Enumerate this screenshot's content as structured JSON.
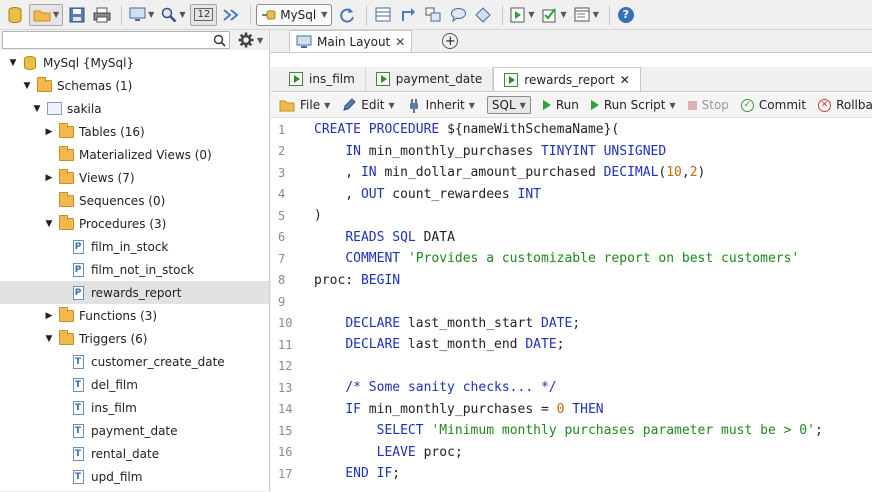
{
  "toolbar": {
    "connection_label": "MySql",
    "badge_number": "12",
    "help_glyph": "?"
  },
  "search": {
    "value": "",
    "placeholder": ""
  },
  "tree": [
    {
      "label": "MySql {MySql}",
      "level": 0,
      "arrow": "down",
      "icon": "database"
    },
    {
      "label": "Schemas (1)",
      "level": 1,
      "arrow": "down",
      "icon": "folder"
    },
    {
      "label": "sakila",
      "level": 2,
      "arrow": "down",
      "icon": "schema"
    },
    {
      "label": "Tables (16)",
      "level": 3,
      "arrow": "right",
      "icon": "folder"
    },
    {
      "label": "Materialized Views (0)",
      "level": 3,
      "arrow": "none",
      "icon": "folder"
    },
    {
      "label": "Views (7)",
      "level": 3,
      "arrow": "right",
      "icon": "folder"
    },
    {
      "label": "Sequences (0)",
      "level": 3,
      "arrow": "none",
      "icon": "folder"
    },
    {
      "label": "Procedures (3)",
      "level": 3,
      "arrow": "down",
      "icon": "folder"
    },
    {
      "label": "film_in_stock",
      "level": 4,
      "arrow": "none",
      "icon": "procedure",
      "glyph": "P"
    },
    {
      "label": "film_not_in_stock",
      "level": 4,
      "arrow": "none",
      "icon": "procedure",
      "glyph": "P"
    },
    {
      "label": "rewards_report",
      "level": 4,
      "arrow": "none",
      "icon": "procedure",
      "glyph": "P",
      "selected": true
    },
    {
      "label": "Functions (3)",
      "level": 3,
      "arrow": "right",
      "icon": "folder"
    },
    {
      "label": "Triggers (6)",
      "level": 3,
      "arrow": "down",
      "icon": "folder"
    },
    {
      "label": "customer_create_date",
      "level": 4,
      "arrow": "none",
      "icon": "trigger",
      "glyph": "T"
    },
    {
      "label": "del_film",
      "level": 4,
      "arrow": "none",
      "icon": "trigger",
      "glyph": "T"
    },
    {
      "label": "ins_film",
      "level": 4,
      "arrow": "none",
      "icon": "trigger",
      "glyph": "T"
    },
    {
      "label": "payment_date",
      "level": 4,
      "arrow": "none",
      "icon": "trigger",
      "glyph": "T"
    },
    {
      "label": "rental_date",
      "level": 4,
      "arrow": "none",
      "icon": "trigger",
      "glyph": "T"
    },
    {
      "label": "upd_film",
      "level": 4,
      "arrow": "none",
      "icon": "trigger",
      "glyph": "T"
    }
  ],
  "main_tab": {
    "label": "Main Layout",
    "close": "✕"
  },
  "sub_tabs": [
    {
      "label": "ins_film",
      "active": false
    },
    {
      "label": "payment_date",
      "active": false
    },
    {
      "label": "rewards_report",
      "active": true,
      "close": "✕"
    }
  ],
  "editor_toolbar": {
    "file": "File",
    "edit": "Edit",
    "inherit": "Inherit",
    "sql": "SQL",
    "run": "Run",
    "run_script": "Run Script",
    "stop": "Stop",
    "commit": "Commit",
    "rollback": "Rollback"
  },
  "code_lines": [
    {
      "n": "1",
      "tokens": [
        [
          "kw",
          "CREATE PROCEDURE "
        ],
        [
          "t",
          "${nameWithSchemaName}("
        ]
      ]
    },
    {
      "n": "2",
      "tokens": [
        [
          "t",
          "    "
        ],
        [
          "kw",
          "IN"
        ],
        [
          "t",
          " min_monthly_purchases "
        ],
        [
          "kw",
          "TINYINT UNSIGNED"
        ]
      ]
    },
    {
      "n": "3",
      "tokens": [
        [
          "t",
          "    , "
        ],
        [
          "kw",
          "IN"
        ],
        [
          "t",
          " min_dollar_amount_purchased "
        ],
        [
          "kw",
          "DECIMAL"
        ],
        [
          "t",
          "("
        ],
        [
          "num",
          "10"
        ],
        [
          "t",
          ","
        ],
        [
          "num",
          "2"
        ],
        [
          "t",
          ")"
        ]
      ]
    },
    {
      "n": "4",
      "tokens": [
        [
          "t",
          "    , "
        ],
        [
          "kw",
          "OUT"
        ],
        [
          "t",
          " count_rewardees "
        ],
        [
          "kw",
          "INT"
        ]
      ]
    },
    {
      "n": "5",
      "tokens": [
        [
          "t",
          ")"
        ]
      ]
    },
    {
      "n": "6",
      "tokens": [
        [
          "t",
          "    "
        ],
        [
          "kw",
          "READS SQL"
        ],
        [
          "t",
          " DATA"
        ]
      ]
    },
    {
      "n": "7",
      "tokens": [
        [
          "t",
          "    "
        ],
        [
          "kw",
          "COMMENT"
        ],
        [
          "t",
          " "
        ],
        [
          "str",
          "'Provides a customizable report on best customers'"
        ]
      ]
    },
    {
      "n": "8",
      "tokens": [
        [
          "t",
          "proc: "
        ],
        [
          "kw",
          "BEGIN"
        ]
      ]
    },
    {
      "n": "9",
      "tokens": []
    },
    {
      "n": "10",
      "tokens": [
        [
          "t",
          "    "
        ],
        [
          "kw",
          "DECLARE"
        ],
        [
          "t",
          " last_month_start "
        ],
        [
          "kw",
          "DATE"
        ],
        [
          "t",
          ";"
        ]
      ]
    },
    {
      "n": "11",
      "tokens": [
        [
          "t",
          "    "
        ],
        [
          "kw",
          "DECLARE"
        ],
        [
          "t",
          " last_month_end "
        ],
        [
          "kw",
          "DATE"
        ],
        [
          "t",
          ";"
        ]
      ]
    },
    {
      "n": "12",
      "tokens": []
    },
    {
      "n": "13",
      "tokens": [
        [
          "t",
          "    "
        ],
        [
          "cm",
          "/* Some sanity checks... */"
        ]
      ]
    },
    {
      "n": "14",
      "tokens": [
        [
          "t",
          "    "
        ],
        [
          "kw",
          "IF"
        ],
        [
          "t",
          " min_monthly_purchases = "
        ],
        [
          "num",
          "0"
        ],
        [
          "t",
          " "
        ],
        [
          "kw",
          "THEN"
        ]
      ]
    },
    {
      "n": "15",
      "tokens": [
        [
          "t",
          "        "
        ],
        [
          "kw",
          "SELECT"
        ],
        [
          "t",
          " "
        ],
        [
          "str",
          "'Minimum monthly purchases parameter must be > 0'"
        ],
        [
          "t",
          ";"
        ]
      ]
    },
    {
      "n": "16",
      "tokens": [
        [
          "t",
          "        "
        ],
        [
          "kw",
          "LEAVE"
        ],
        [
          "t",
          " proc;"
        ]
      ]
    },
    {
      "n": "17",
      "tokens": [
        [
          "t",
          "    "
        ],
        [
          "kw",
          "END IF"
        ],
        [
          "t",
          ";"
        ]
      ]
    }
  ],
  "colors": {
    "keyword": "#1f2fbf",
    "string": "#1a8a1a",
    "number": "#c06a00",
    "selection": "#e2e2e2"
  }
}
